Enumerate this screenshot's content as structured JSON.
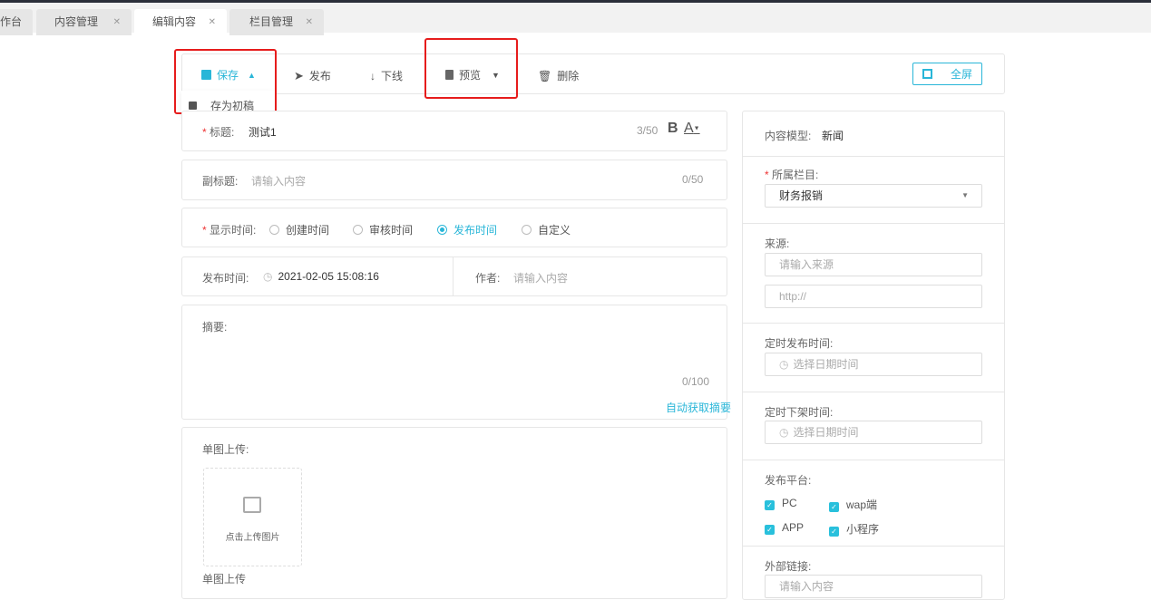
{
  "tabs": [
    {
      "label": "作台",
      "closable": false
    },
    {
      "label": "内容管理",
      "closable": true
    },
    {
      "label": "编辑内容",
      "closable": true,
      "active": true
    },
    {
      "label": "栏目管理",
      "closable": true
    }
  ],
  "toolbar": {
    "save": "保存",
    "save_draft": "存为初稿",
    "publish": "发布",
    "offline": "下线",
    "preview": "预览",
    "delete": "删除",
    "fullscreen": "全屏",
    "accent": "#29b6d8"
  },
  "form": {
    "title_label": "标题:",
    "title_value": "测试1",
    "title_count": "3/50",
    "bold": "B",
    "font_color": "A",
    "subtitle_label": "副标题:",
    "subtitle_placeholder": "请输入内容",
    "subtitle_count": "0/50",
    "display_time_label": "显示时间:",
    "display_time_options": [
      "创建时间",
      "审核时间",
      "发布时间",
      "自定义"
    ],
    "display_time_selected": "发布时间",
    "publish_time_label": "发布时间:",
    "publish_time_value": "2021-02-05 15:08:16",
    "author_label": "作者:",
    "author_placeholder": "请输入内容",
    "summary_label": "摘要:",
    "summary_count": "0/100",
    "auto_summary": "自动获取摘要",
    "upload_label": "单图上传:",
    "upload_button": "点击上传图片",
    "upload_caption": "单图上传"
  },
  "side": {
    "model_label": "内容模型:",
    "model_value": "新闻",
    "column_label": "所属栏目:",
    "column_value": "财务报销",
    "source_label": "来源:",
    "source_placeholder": "请输入来源",
    "source_url_placeholder": "http://",
    "schedule_publish_label": "定时发布时间:",
    "schedule_offline_label": "定时下架时间:",
    "datetime_placeholder": "选择日期时间",
    "platform_label": "发布平台:",
    "platforms": [
      {
        "label": "PC",
        "checked": true
      },
      {
        "label": "wap端",
        "checked": true
      },
      {
        "label": "APP",
        "checked": true
      },
      {
        "label": "小程序",
        "checked": true
      }
    ],
    "external_link_label": "外部链接:",
    "external_link_placeholder": "请输入内容"
  }
}
